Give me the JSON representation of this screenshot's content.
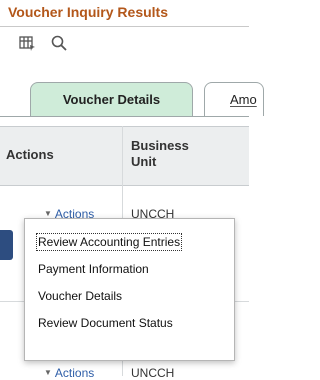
{
  "page": {
    "title": "Voucher Inquiry Results"
  },
  "toolbar": {
    "icons": [
      "grid-options-icon",
      "search-icon"
    ]
  },
  "tabs": [
    {
      "label": "Voucher Details",
      "active": true
    },
    {
      "label": "Amo",
      "active": false
    }
  ],
  "grid": {
    "columns": [
      "Actions",
      "Business Unit"
    ],
    "rows": [
      {
        "actions": "Actions",
        "business_unit": "UNCCH"
      },
      {
        "actions": "Actions",
        "business_unit": "UNCCH"
      }
    ]
  },
  "menu": {
    "items": [
      "Review Accounting Entries",
      "Payment Information",
      "Voucher Details",
      "Review Document Status"
    ]
  },
  "colors": {
    "title": "#b3571a",
    "active_tab": "#cfecd9",
    "link": "#2e5ea8",
    "side_handle": "#2d4d80"
  }
}
